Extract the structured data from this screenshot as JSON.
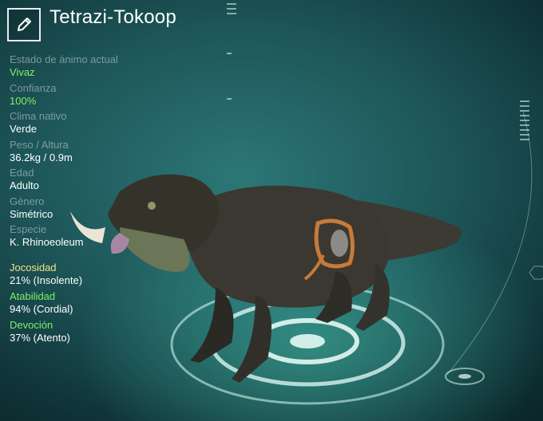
{
  "creature": {
    "name": "Tetrazi-Tokoop"
  },
  "edit_button": {
    "icon": "pencil-icon"
  },
  "stats": [
    {
      "label": "Estado de ánimo actual",
      "value": "Vivaz"
    },
    {
      "label": "Confianza",
      "value": "100%"
    },
    {
      "label": "Clima nativo",
      "value": "Verde"
    },
    {
      "label": "Peso / Altura",
      "value": "36.2kg / 0.9m"
    },
    {
      "label": "Edad",
      "value": "Adulto"
    },
    {
      "label": "Género",
      "value": "Simétrico"
    },
    {
      "label": "Especie",
      "value": "K. Rhinoeoleum"
    }
  ],
  "traits": [
    {
      "label": "Jocosidad",
      "value": "21% (Insolente)",
      "color": "#f0e58a"
    },
    {
      "label": "Atabilidad",
      "value": "94% (Cordial)",
      "color": "#7df06a"
    },
    {
      "label": "Devoción",
      "value": "37% (Atento)",
      "color": "#7df06a"
    }
  ],
  "colors": {
    "highlight_green": "#7df06a",
    "trait_yellow": "#f0e58a"
  }
}
